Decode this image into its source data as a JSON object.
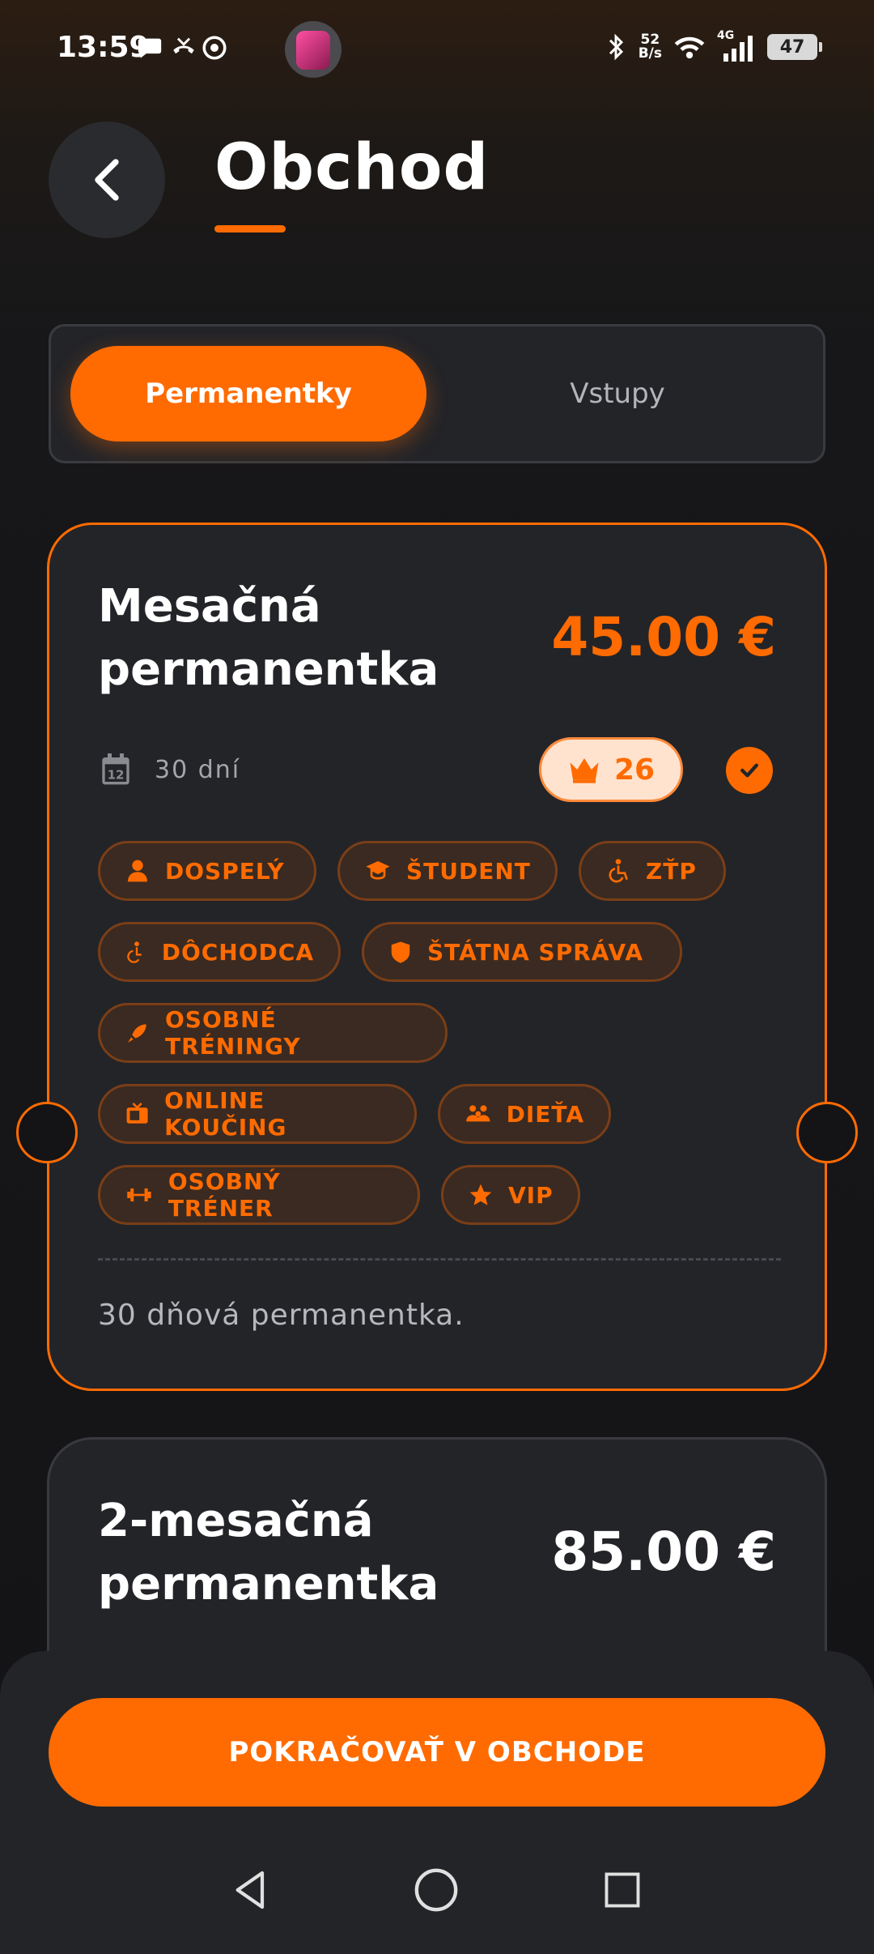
{
  "status_bar": {
    "time": "13:59",
    "net_speed_value": "52",
    "net_speed_unit": "B/s",
    "signal_type": "4G",
    "battery": "47"
  },
  "header": {
    "title": "Obchod",
    "accent_color": "#ff6b00"
  },
  "tabs": [
    {
      "label": "Permanentky",
      "active": true
    },
    {
      "label": "Vstupy",
      "active": false
    }
  ],
  "cards": [
    {
      "name_line1": "Mesačná",
      "name_line2": "permanentka",
      "price": "45.00 €",
      "duration": "30 dní",
      "credits": "26",
      "selected": true,
      "tags": [
        {
          "label": "DOSPELÝ",
          "icon": "person-icon"
        },
        {
          "label": "ŠTUDENT",
          "icon": "graduation-cap-icon"
        },
        {
          "label": "ZŤP",
          "icon": "wheelchair-icon"
        },
        {
          "label": "DÔCHODCA",
          "icon": "senior-icon"
        },
        {
          "label": "ŠTÁTNA SPRÁVA",
          "icon": "shield-icon"
        },
        {
          "label": "OSOBNÉ TRÉNINGY",
          "icon": "rocket-icon"
        },
        {
          "label": "ONLINE KOUČING",
          "icon": "tv-icon"
        },
        {
          "label": "DIEŤA",
          "icon": "family-icon"
        },
        {
          "label": "OSOBNÝ TRÉNER",
          "icon": "dumbbell-icon"
        },
        {
          "label": "VIP",
          "icon": "star-icon"
        }
      ],
      "description": "30 dňová permanentka."
    },
    {
      "name_line1": "2-mesačná",
      "name_line2": "permanentka",
      "price": "85.00 €"
    }
  ],
  "bottom": {
    "continue_label": "POKRAČOVAŤ V OBCHODE"
  }
}
